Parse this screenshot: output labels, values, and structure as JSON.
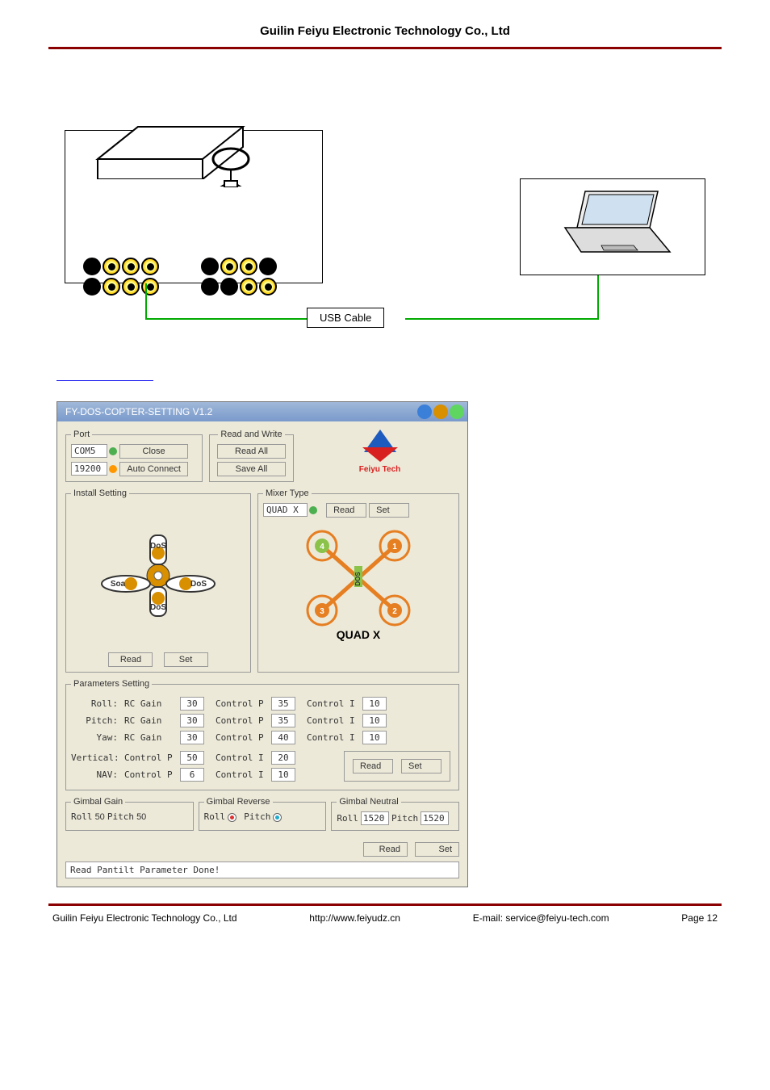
{
  "header": {
    "title": "Guilin Feiyu Electronic Technology Co., Ltd"
  },
  "diagram": {
    "usb_cable": "USB Cable"
  },
  "window": {
    "title": "FY-DOS-COPTER-SETTING V1.2",
    "port": {
      "legend": "Port",
      "com": "COM5",
      "baud": "19200",
      "close_btn": "Close",
      "auto_connect_btn": "Auto Connect"
    },
    "read_write": {
      "legend": "Read and Write",
      "read_all": "Read All",
      "save_all": "Save All"
    },
    "logo_text": "Feiyu Tech",
    "install_setting": {
      "legend": "Install Setting",
      "read_btn": "Read",
      "set_btn": "Set",
      "dos_label": "DoS"
    },
    "mixer_type": {
      "legend": "Mixer Type",
      "selected": "QUAD X",
      "read_btn": "Read",
      "set_btn": "Set",
      "caption": "QUAD X",
      "dos_label": "DOS"
    },
    "parameters": {
      "legend": "Parameters Setting",
      "rows": [
        {
          "name": "Roll:",
          "c1l": "RC Gain",
          "c1v": "30",
          "c2l": "Control P",
          "c2v": "35",
          "c3l": "Control I",
          "c3v": "10"
        },
        {
          "name": "Pitch:",
          "c1l": "RC Gain",
          "c1v": "30",
          "c2l": "Control P",
          "c2v": "35",
          "c3l": "Control I",
          "c3v": "10"
        },
        {
          "name": "Yaw:",
          "c1l": "RC Gain",
          "c1v": "30",
          "c2l": "Control P",
          "c2v": "40",
          "c3l": "Control I",
          "c3v": "10"
        },
        {
          "name": "Vertical:",
          "c1l": "Control P",
          "c1v": "50",
          "c2l": "Control I",
          "c2v": "20",
          "c3l": "",
          "c3v": ""
        },
        {
          "name": "NAV:",
          "c1l": "Control P",
          "c1v": "6",
          "c2l": "Control I",
          "c2v": "10",
          "c3l": "",
          "c3v": ""
        }
      ],
      "read_btn": "Read",
      "set_btn": "Set"
    },
    "gimbal_gain": {
      "legend": "Gimbal Gain",
      "roll_label": "Roll",
      "roll_val": "50",
      "pitch_label": "Pitch",
      "pitch_val": "50"
    },
    "gimbal_reverse": {
      "legend": "Gimbal Reverse",
      "roll_label": "Roll",
      "pitch_label": "Pitch"
    },
    "gimbal_neutral": {
      "legend": "Gimbal Neutral",
      "roll_label": "Roll",
      "roll_val": "1520",
      "pitch_label": "Pitch",
      "pitch_val": "1520"
    },
    "global_read": "Read",
    "global_set": "Set",
    "status": "Read Pantilt Parameter Done!"
  },
  "footer": {
    "company": "Guilin Feiyu Electronic Technology Co., Ltd",
    "url": "http://www.feiyudz.cn",
    "email_label": "E-mail: service@feiyu-tech.com",
    "page": "Page 12"
  }
}
